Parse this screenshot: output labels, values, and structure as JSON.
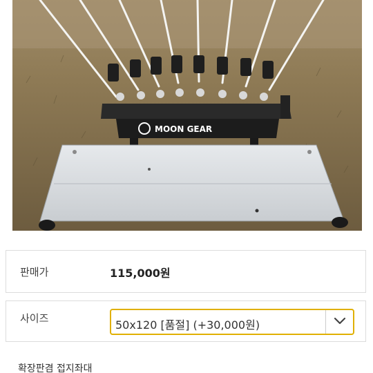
{
  "product": {
    "image_alt": "MOON GEAR",
    "image_logo_text": "MOON GEAR"
  },
  "price": {
    "label": "판매가",
    "value": "115,000원"
  },
  "size": {
    "label": "사이즈",
    "selected": "50x120 [품절] (+30,000원)"
  },
  "section": {
    "title": "확장판겸 접지좌대"
  },
  "colors": {
    "select_border": "#e0b000",
    "box_border": "#dcdcdc"
  },
  "icons": {
    "dropdown": "chevron-down-icon"
  }
}
